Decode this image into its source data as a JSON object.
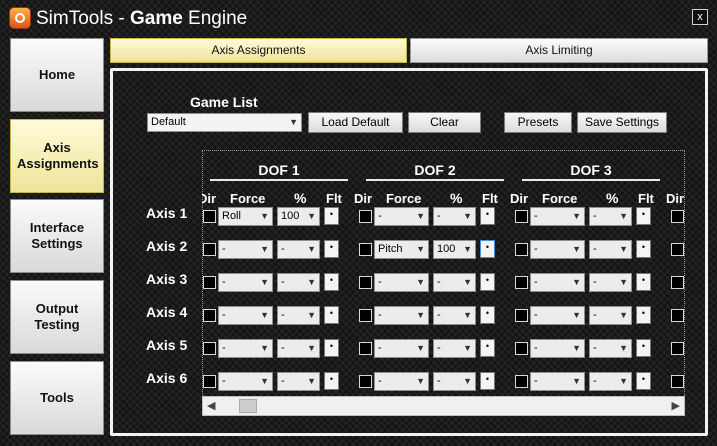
{
  "window": {
    "title_prefix": "SimTools - ",
    "title_bold": "Game",
    "title_suffix": " Engine",
    "close_label": "x"
  },
  "nav": [
    {
      "label": "Home",
      "active": false
    },
    {
      "label": "Axis Assignments",
      "active": true
    },
    {
      "label": "Interface Settings",
      "active": false
    },
    {
      "label": "Output Testing",
      "active": false
    },
    {
      "label": "Tools",
      "active": false
    }
  ],
  "tabs": [
    {
      "label": "Axis Assignments",
      "active": true
    },
    {
      "label": "Axis Limiting",
      "active": false
    }
  ],
  "game_list": {
    "label": "Game List",
    "selected": "Default"
  },
  "buttons": {
    "load_default": "Load Default",
    "clear": "Clear",
    "presets": "Presets",
    "save_settings": "Save Settings"
  },
  "dofs": [
    "DOF 1",
    "DOF 2",
    "DOF 3"
  ],
  "columns": {
    "dir": "Dir",
    "force": "Force",
    "percent": "%",
    "flt": "Flt"
  },
  "axes": [
    {
      "label": "Axis 1",
      "cells": [
        {
          "force": "Roll",
          "percent": "100"
        },
        {
          "force": "-",
          "percent": "-"
        },
        {
          "force": "-",
          "percent": "-"
        }
      ]
    },
    {
      "label": "Axis 2",
      "cells": [
        {
          "force": "-",
          "percent": "-"
        },
        {
          "force": "Pitch",
          "percent": "100"
        },
        {
          "force": "-",
          "percent": "-"
        }
      ]
    },
    {
      "label": "Axis 3",
      "cells": [
        {
          "force": "-",
          "percent": "-"
        },
        {
          "force": "-",
          "percent": "-"
        },
        {
          "force": "-",
          "percent": "-"
        }
      ]
    },
    {
      "label": "Axis 4",
      "cells": [
        {
          "force": "-",
          "percent": "-"
        },
        {
          "force": "-",
          "percent": "-"
        },
        {
          "force": "-",
          "percent": "-"
        }
      ]
    },
    {
      "label": "Axis 5",
      "cells": [
        {
          "force": "-",
          "percent": "-"
        },
        {
          "force": "-",
          "percent": "-"
        },
        {
          "force": "-",
          "percent": "-"
        }
      ]
    },
    {
      "label": "Axis 6",
      "cells": [
        {
          "force": "-",
          "percent": "-"
        },
        {
          "force": "-",
          "percent": "-"
        },
        {
          "force": "-",
          "percent": "-"
        }
      ]
    }
  ],
  "icons": {
    "dropdown": "chevron-down-icon",
    "scroll_left": "arrow-left-icon",
    "scroll_right": "arrow-right-icon"
  }
}
